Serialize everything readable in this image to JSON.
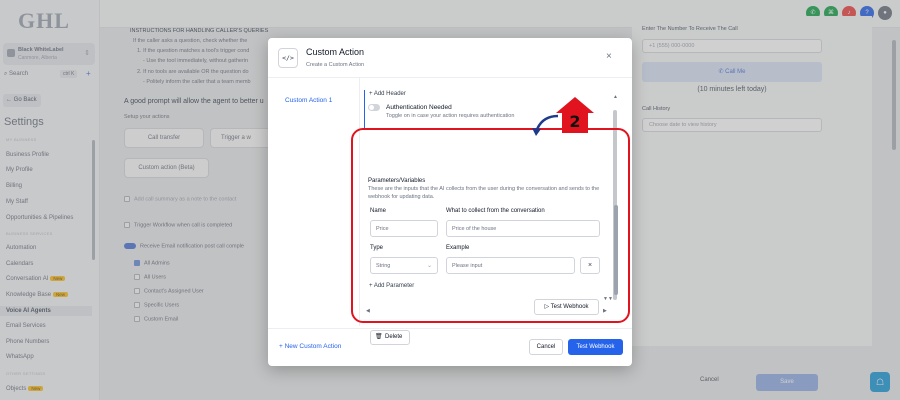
{
  "logo": "GHL",
  "account": {
    "name": "Black WhiteLabel",
    "location": "Canmore, Alberta"
  },
  "search": {
    "label": "Search",
    "shortcut": "ctrl K"
  },
  "go_back": "← Go Back",
  "settings_title": "Settings",
  "nav": {
    "section_my_business": "MY BUSINESS",
    "business_profile": "Business Profile",
    "my_profile": "My Profile",
    "billing": "Billing",
    "my_staff": "My Staff",
    "opportunities": "Opportunities & Pipelines",
    "section_business_services": "BUSINESS SERVICES",
    "automation": "Automation",
    "calendars": "Calendars",
    "conversation_ai": "Conversation AI",
    "knowledge_base": "Knowledge Base",
    "voice_ai_agents": "Voice AI Agents",
    "email_services": "Email Services",
    "phone_numbers": "Phone Numbers",
    "whatsapp": "WhatsApp",
    "section_other": "OTHER SETTINGS",
    "objects": "Objects",
    "new_badge": "New"
  },
  "background": {
    "instructions_title": "INSTRUCTIONS FOR HANDLING CALLER'S QUERIES",
    "line1": "If the caller asks a question, check whether the",
    "line2": "1. If the question matches a tool's trigger cond",
    "line3": "- Use the tool immediately, without gatherin",
    "line4": "2. If no tools are available OR the question do",
    "line5": "- Politely inform the caller that a team memb",
    "good_prompt": "A good prompt will allow the agent to better u",
    "setup_actions": "Setup your actions",
    "call_transfer": "Call transfer",
    "trigger_w": "Trigger a w",
    "custom_action_beta": "Custom action (Beta)",
    "add_call_summary": "Add call summary as a note to the contact",
    "trigger_workflow": "Trigger Workflow when call is completed",
    "receive_email": "Receive Email notification post call comple",
    "all_admins": "All Admins",
    "all_users": "All Users",
    "contact_assigned": "Contact's Assigned User",
    "specific_users": "Specific Users",
    "custom_email": "Custom Email",
    "enter_number_label": "Enter The Number To Receive The Call",
    "phone_placeholder": "+1 (555) 000-0000",
    "call_me": "Call Me",
    "minutes_left": "(10 minutes left today)",
    "call_history": "Call History",
    "date_placeholder": "Choose date to view history",
    "cancel": "Cancel",
    "save": "Save"
  },
  "modal": {
    "title": "Custom Action",
    "subtitle": "Create a Custom Action",
    "side_item": "Custom Action 1",
    "add_header": "+ Add Header",
    "auth_label": "Authentication Needed",
    "auth_desc": "Toggle on in case your action requires authentication",
    "params_title": "Parameters/Variables",
    "params_desc": "These are the inputs that the AI collects from the user during the conversation and sends to the webhook for updating data.",
    "col_name": "Name",
    "col_collect": "What to collect from the conversation",
    "name_placeholder": "Price",
    "collect_placeholder": "Price of the house",
    "col_type": "Type",
    "col_example": "Example",
    "type_value": "String",
    "example_placeholder": "Please input",
    "add_parameter": "+ Add Parameter",
    "test_webhook_inline": "Test Webhook",
    "delete": "Delete",
    "new_custom_action": "+ New Custom Action",
    "cancel": "Cancel",
    "test_webhook": "Test Webhook"
  },
  "annotation": {
    "step_number": "2",
    "color": "#e0131f"
  },
  "colors": {
    "primary": "#2563eb",
    "annotation": "#e0131f"
  }
}
